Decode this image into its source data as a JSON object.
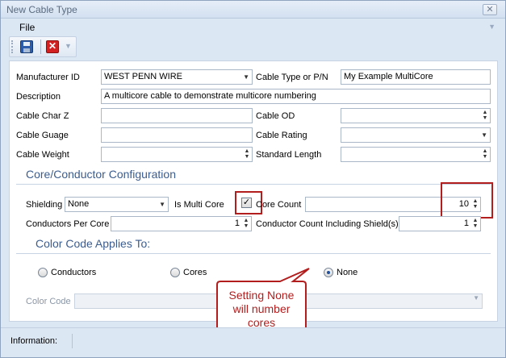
{
  "window": {
    "title": "New Cable Type",
    "close_glyph": "✕"
  },
  "menu": {
    "file_label": "File"
  },
  "toolbar": {
    "save_icon": "save-icon",
    "cancel_icon": "cancel-icon",
    "cancel_glyph": "✕"
  },
  "form": {
    "manufacturer_id": {
      "label": "Manufacturer ID",
      "value": "WEST PENN WIRE"
    },
    "cable_type": {
      "label": "Cable Type or P/N",
      "value": "My Example MultiCore"
    },
    "description": {
      "label": "Description",
      "value": "A multicore cable to demonstrate multicore numbering"
    },
    "cable_char_z": {
      "label": "Cable Char Z",
      "value": ""
    },
    "cable_od": {
      "label": "Cable OD",
      "value": ""
    },
    "cable_guage": {
      "label": "Cable Guage",
      "value": ""
    },
    "cable_rating": {
      "label": "Cable Rating",
      "value": ""
    },
    "cable_weight": {
      "label": "Cable Weight",
      "value": ""
    },
    "standard_length": {
      "label": "Standard Length",
      "value": ""
    }
  },
  "core_section": {
    "title": "Core/Conductor Configuration",
    "shielding": {
      "label": "Shielding",
      "value": "None"
    },
    "is_multi_core": {
      "label": "Is Multi Core",
      "checked": true,
      "glyph": "✓"
    },
    "core_count": {
      "label": "Core Count",
      "value": "10"
    },
    "conductors_per_core": {
      "label": "Conductors Per Core",
      "value": "1"
    },
    "conductor_count_shield": {
      "label": "Conductor Count Including Shield(s)",
      "value": "1"
    }
  },
  "color_code_section": {
    "title": "Color Code Applies To:",
    "options": [
      {
        "label": "Conductors",
        "selected": false
      },
      {
        "label": "Cores",
        "selected": false
      },
      {
        "label": "None",
        "selected": true
      }
    ],
    "color_code_label": "Color Code"
  },
  "callout": {
    "line1": "Setting None",
    "line2": "will number",
    "line3": "cores"
  },
  "status": {
    "information_label": "Information:"
  },
  "colors": {
    "accent": "#3b5c8e",
    "highlight": "#b21e1e",
    "window_bg": "#dce7f4"
  }
}
